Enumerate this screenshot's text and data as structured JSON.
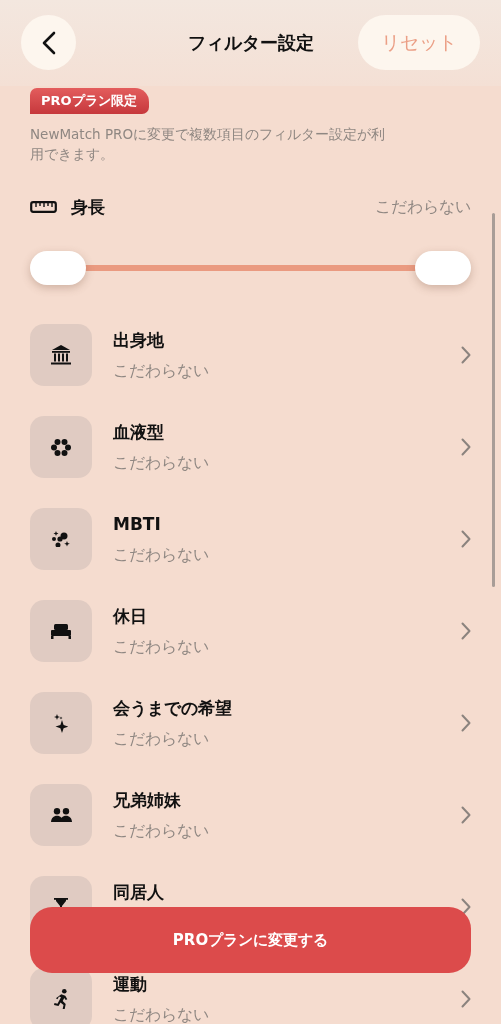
{
  "header": {
    "title": "フィルター設定",
    "reset_label": "リセット"
  },
  "pro_badge": "PROプラン限定",
  "description": "NewMatch PROに変更で複数項目のフィルター設定が利用できます。",
  "height_filter": {
    "label": "身長",
    "value": "こだわらない",
    "thumbs": [
      {
        "level": 0
      },
      {
        "level": 1
      }
    ]
  },
  "items": [
    {
      "title": "出身地",
      "value": "こだわらない"
    },
    {
      "title": "血液型",
      "value": "こだわらない"
    },
    {
      "title": "MBTI",
      "value": "こだわらない"
    },
    {
      "title": "休日",
      "value": "こだわらない"
    },
    {
      "title": "会うまでの希望",
      "value": "こだわらない"
    },
    {
      "title": "兄弟姉妹",
      "value": "こだわらない"
    },
    {
      "title": "同居人"
    },
    {
      "title": "運動",
      "value": "こだわらない"
    }
  ],
  "upgrade_button": "PROプランに変更する"
}
